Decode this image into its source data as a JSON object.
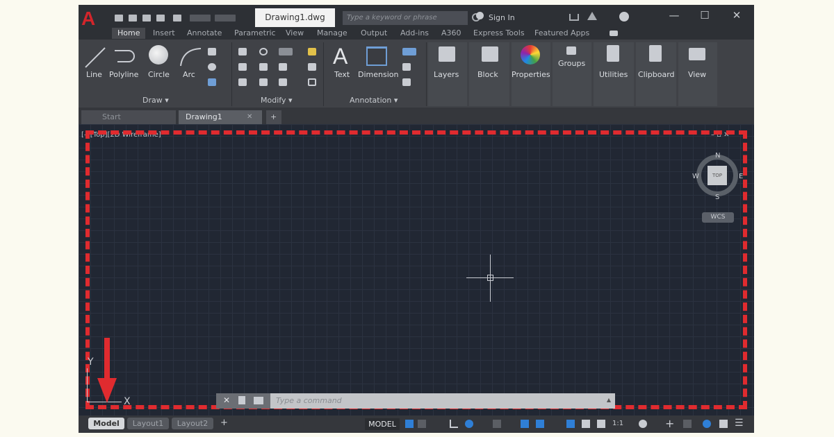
{
  "app": {
    "logo_letter": "A",
    "doc_title": "Drawing1.dwg"
  },
  "search": {
    "placeholder": "Type a keyword or phrase"
  },
  "account": {
    "sign_in": "Sign In"
  },
  "window_controls": {
    "minimize": "—",
    "maximize": "☐",
    "close": "✕"
  },
  "ribbon_tabs": [
    "Home",
    "Insert",
    "Annotate",
    "Parametric",
    "View",
    "Manage",
    "Output",
    "Add-ins",
    "A360",
    "Express Tools",
    "Featured Apps"
  ],
  "ribbon": {
    "draw": {
      "line": "Line",
      "polyline": "Polyline",
      "circle": "Circle",
      "arc": "Arc",
      "title": "Draw ▾"
    },
    "modify": {
      "title": "Modify ▾"
    },
    "annotation": {
      "text": "Text",
      "dimension": "Dimension",
      "title": "Annotation ▾"
    },
    "groups_panels": {
      "layers": "Layers",
      "block": "Block",
      "properties": "Properties",
      "groups": "Groups",
      "utilities": "Utilities",
      "clipboard": "Clipboard",
      "view": "View"
    }
  },
  "file_tabs": {
    "start": "Start",
    "drawing": "Drawing1",
    "add": "+"
  },
  "viewport": {
    "label": "[–][Top][2D Wireframe]"
  },
  "viewcube": {
    "n": "N",
    "s": "S",
    "e": "E",
    "w": "W",
    "top": "TOP",
    "wcs": "WCS"
  },
  "ucs": {
    "y": "Y",
    "x": "X"
  },
  "command": {
    "placeholder": "Type a command"
  },
  "layout_tabs": [
    "Model",
    "Layout1",
    "Layout2"
  ],
  "status": {
    "model": "MODEL",
    "scale": "1:1"
  },
  "colors": {
    "accent_red": "#e02b2f",
    "canvas": "#212733",
    "blue": "#2f7fd6"
  }
}
